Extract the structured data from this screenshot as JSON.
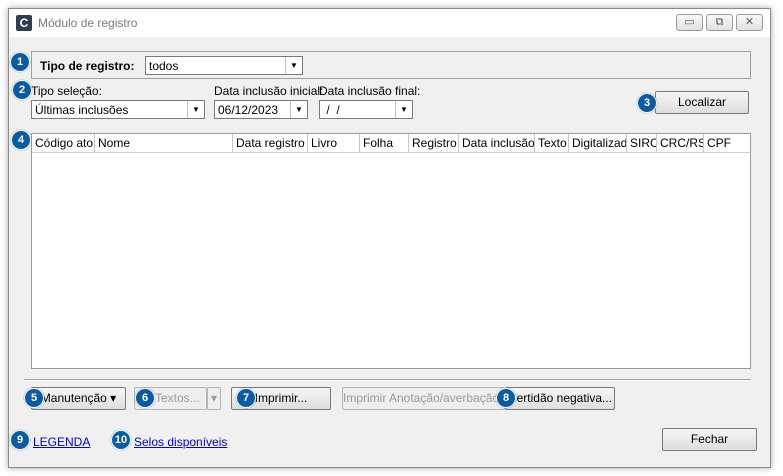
{
  "window": {
    "title": "Módulo de registro",
    "icon_letter": "C"
  },
  "titlebar_buttons": {
    "minimize": "▭",
    "maximize": "⧉",
    "close": "✕"
  },
  "badges": [
    "1",
    "2",
    "3",
    "4",
    "5",
    "6",
    "7",
    "8",
    "9",
    "10"
  ],
  "tipo_registro": {
    "label": "Tipo de registro:",
    "value": "todos"
  },
  "filters": {
    "tipo_selecao_label": "Tipo seleção:",
    "tipo_selecao_value": "Últimas inclusões",
    "data_inicial_label": "Data inclusão inicial:",
    "data_inicial_value": "06/12/2023",
    "data_final_label": "Data inclusão final:",
    "data_final_value": " /  /"
  },
  "localizar_label": "Localizar",
  "grid": {
    "columns": [
      "Código ato",
      "Nome",
      "Data registro",
      "Livro",
      "Folha",
      "Registro",
      "Data inclusão",
      "Texto",
      "Digitalizado",
      "SIRC",
      "CRC/RS",
      "CPF"
    ]
  },
  "buttons": {
    "manutencao": "Manutenção ▾",
    "textos": "Textos...",
    "textos_arrow": "▾",
    "imprimir": "Imprimir...",
    "imprimir_anotacao": "Imprimir Anotação/averbação...",
    "certidao": "Certidão negativa...",
    "fechar": "Fechar"
  },
  "links": {
    "legenda": "LEGENDA",
    "selos": "Selos disponíveis"
  },
  "colors": {
    "badge": "#0d5a9e",
    "link": "#0000cc"
  }
}
